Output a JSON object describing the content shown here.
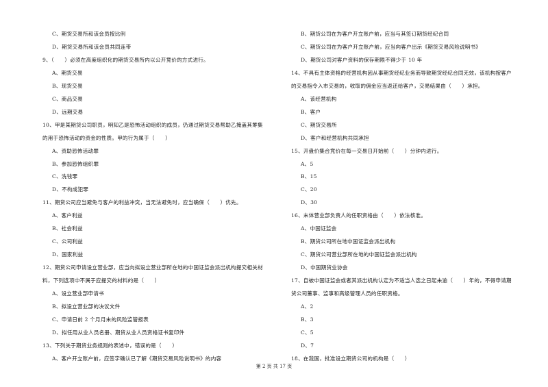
{
  "left": [
    {
      "type": "opt",
      "text": "C、期货交易所和该会员按比例"
    },
    {
      "type": "opt",
      "text": "D、期货交易所和该会员共同连带"
    },
    {
      "type": "q",
      "text": "9、（　　）必须在高度组织化的期货交易所内以公开竞价的方式进行。"
    },
    {
      "type": "opt",
      "text": "A、期货交易"
    },
    {
      "type": "opt",
      "text": "B、现货交易"
    },
    {
      "type": "opt",
      "text": "C、商品交易"
    },
    {
      "type": "opt",
      "text": "D、远期交易"
    },
    {
      "type": "q",
      "text": "10、甲是某期货公司职员，明知乙是恐怖活动组织的成员，仍通过期货交易帮助乙掩盖其筹集"
    },
    {
      "type": "q",
      "text": "的用于恐怖活动的资金的性质。甲的行为属于（　　）"
    },
    {
      "type": "opt",
      "text": "A、资助恐怖活动罪"
    },
    {
      "type": "opt",
      "text": "B、参加恐怖组织罪"
    },
    {
      "type": "opt",
      "text": "C、洗钱罪"
    },
    {
      "type": "opt",
      "text": "D、不构成犯罪"
    },
    {
      "type": "q",
      "text": "11、期货公司应当避免与客户的利益冲突，当无法避免时，应当确保（　　）优先。"
    },
    {
      "type": "opt",
      "text": "A、客户利益"
    },
    {
      "type": "opt",
      "text": "B、社会利益"
    },
    {
      "type": "opt",
      "text": "C、公司利益"
    },
    {
      "type": "opt",
      "text": "D、国家利益"
    },
    {
      "type": "q",
      "text": "12、期货公司申请设立营业部，应当向拟设立营业部所在地的中国证监会派出机构提交相关材"
    },
    {
      "type": "q",
      "text": "料，下列选项中不属于应提交的材料的是（　　）"
    },
    {
      "type": "opt",
      "text": "A、设立营业部申请书"
    },
    {
      "type": "opt",
      "text": "B、拟设立营业部的决议文件"
    },
    {
      "type": "opt",
      "text": "C、申请日前 2 个月月末的风险监管报表"
    },
    {
      "type": "opt",
      "text": "D、拟任用从业人员名册、期货从业人员资格证书复印件"
    },
    {
      "type": "q",
      "text": "13、下列关于期货业务规则的表述中，错误的是（　　）"
    },
    {
      "type": "opt",
      "text": "A、客户开立账户前，应签字确认已了解《期货交易风险说明书》的内容"
    }
  ],
  "right": [
    {
      "type": "opt",
      "text": "B、期货公司在为客户开立账户前，应当与其签订期货经纪合同"
    },
    {
      "type": "opt",
      "text": "C、期货公司在为客户开立账户前，应当向客户出示《期货交易风险说明书》"
    },
    {
      "type": "opt",
      "text": "D、期货公司对客户资料的保存期限不得少于 10 年"
    },
    {
      "type": "q",
      "text": "14、不具有主体资格的经营机构因从事期货经纪业务而导致期货经纪合同无效，该机构按客户"
    },
    {
      "type": "q",
      "text": "的交易指令入市交易的，收取的佣金应当返还给客户，交易结果由（　　）承担。"
    },
    {
      "type": "opt",
      "text": "A、该经营机构"
    },
    {
      "type": "opt",
      "text": "B、客户"
    },
    {
      "type": "opt",
      "text": "C、期货交易所"
    },
    {
      "type": "opt",
      "text": "D、客户和经营机构共同承担"
    },
    {
      "type": "q",
      "text": "15、开盘价集合竞价在每一交易日开始前（　　）分钟内进行。"
    },
    {
      "type": "opt",
      "text": "A、5"
    },
    {
      "type": "opt",
      "text": "B、15"
    },
    {
      "type": "opt",
      "text": "C、20"
    },
    {
      "type": "opt",
      "text": "D、30"
    },
    {
      "type": "q",
      "text": "16、末体营业部负责人的任职资格由（　　）依法核准。"
    },
    {
      "type": "opt",
      "text": "A、中国证监会"
    },
    {
      "type": "opt",
      "text": "B、期货公司所在地中国证监会派出机构"
    },
    {
      "type": "opt",
      "text": "C、期货公司营业部所在地的中国证监会派出机构"
    },
    {
      "type": "opt",
      "text": "D、中国期货业协会"
    },
    {
      "type": "q",
      "text": "17、自被中国证监会或者其派出机构认定为不适当人选之日起未逾（　　）年的，不得申请期"
    },
    {
      "type": "q",
      "text": "货公司董事、监事和高级管理人员的任职资格。"
    },
    {
      "type": "opt",
      "text": "A、2"
    },
    {
      "type": "opt",
      "text": "B、3"
    },
    {
      "type": "opt",
      "text": "C、5"
    },
    {
      "type": "opt",
      "text": "D、7"
    },
    {
      "type": "q",
      "text": "18、在我国，批准设立期货公司的机构是（　　）"
    }
  ],
  "footer": "第 2 页 共 17 页"
}
